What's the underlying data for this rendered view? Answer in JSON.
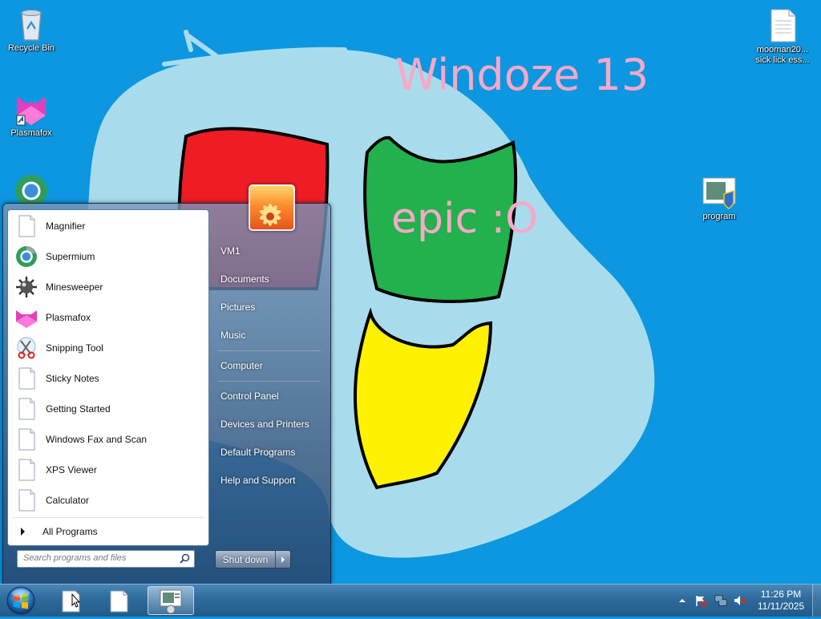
{
  "wallpaper": {
    "title": "Windoze 13",
    "caption": "epic :O",
    "colors": {
      "background": "#0c97e0",
      "cloud": "#a8dcec",
      "red": "#ee1c24",
      "green": "#22b14c",
      "yellow": "#fff200",
      "text": "#f7a8c8"
    }
  },
  "desktop": {
    "icons": [
      {
        "label": "Recycle Bin",
        "icon": "recycle-bin-icon"
      },
      {
        "label": "Plasmafox",
        "icon": "plasmafox-icon"
      },
      {
        "label": "mooman20...\nsick lick ess...",
        "icon": "text-document-icon"
      },
      {
        "label": "program",
        "icon": "program-icon"
      }
    ]
  },
  "start_menu": {
    "programs": [
      {
        "label": "Magnifier",
        "icon": "blank-document-icon"
      },
      {
        "label": "Supermium",
        "icon": "supermium-icon"
      },
      {
        "label": "Minesweeper",
        "icon": "mine-icon"
      },
      {
        "label": "Plasmafox",
        "icon": "plasmafox-icon"
      },
      {
        "label": "Snipping Tool",
        "icon": "scissors-icon"
      },
      {
        "label": "Sticky Notes",
        "icon": "blank-document-icon"
      },
      {
        "label": "Getting Started",
        "icon": "blank-document-icon"
      },
      {
        "label": "Windows Fax and Scan",
        "icon": "blank-document-icon"
      },
      {
        "label": "XPS Viewer",
        "icon": "blank-document-icon"
      },
      {
        "label": "Calculator",
        "icon": "blank-document-icon"
      }
    ],
    "all_programs_label": "All Programs",
    "search_placeholder": "Search programs and files",
    "user_name": "VM1",
    "links": [
      "Documents",
      "Pictures",
      "Music",
      "Computer",
      "Control Panel",
      "Devices and Printers",
      "Default Programs",
      "Help and Support"
    ],
    "shutdown_label": "Shut down"
  },
  "taskbar": {
    "pinned": [
      "document-icon",
      "document-icon",
      "program-icon"
    ],
    "tray": [
      "chevron-up-icon",
      "action-center-flag-icon",
      "network-icon",
      "speaker-muted-icon"
    ],
    "clock": {
      "time": "11:26 PM",
      "date": "11/11/2025"
    }
  }
}
